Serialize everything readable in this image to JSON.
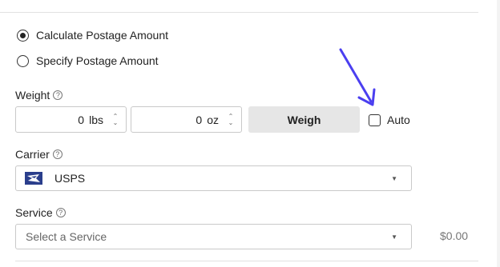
{
  "postage_options": [
    {
      "label": "Calculate Postage Amount",
      "selected": true
    },
    {
      "label": "Specify Postage Amount",
      "selected": false
    }
  ],
  "weight": {
    "label": "Weight",
    "lbs_value": "0",
    "lbs_unit": "lbs",
    "oz_value": "0",
    "oz_unit": "oz",
    "weigh_button": "Weigh",
    "auto_label": "Auto",
    "auto_checked": false
  },
  "carrier": {
    "label": "Carrier",
    "selected": "USPS",
    "logo_icon": "usps-eagle-icon"
  },
  "service": {
    "label": "Service",
    "placeholder": "Select a Service",
    "price": "$0.00"
  },
  "annotation": {
    "arrow_color": "#4b3ff0",
    "icon": "pointer-arrow-icon"
  },
  "colors": {
    "usps_blue": "#2a3e8c",
    "button_bg": "#e6e6e6"
  }
}
